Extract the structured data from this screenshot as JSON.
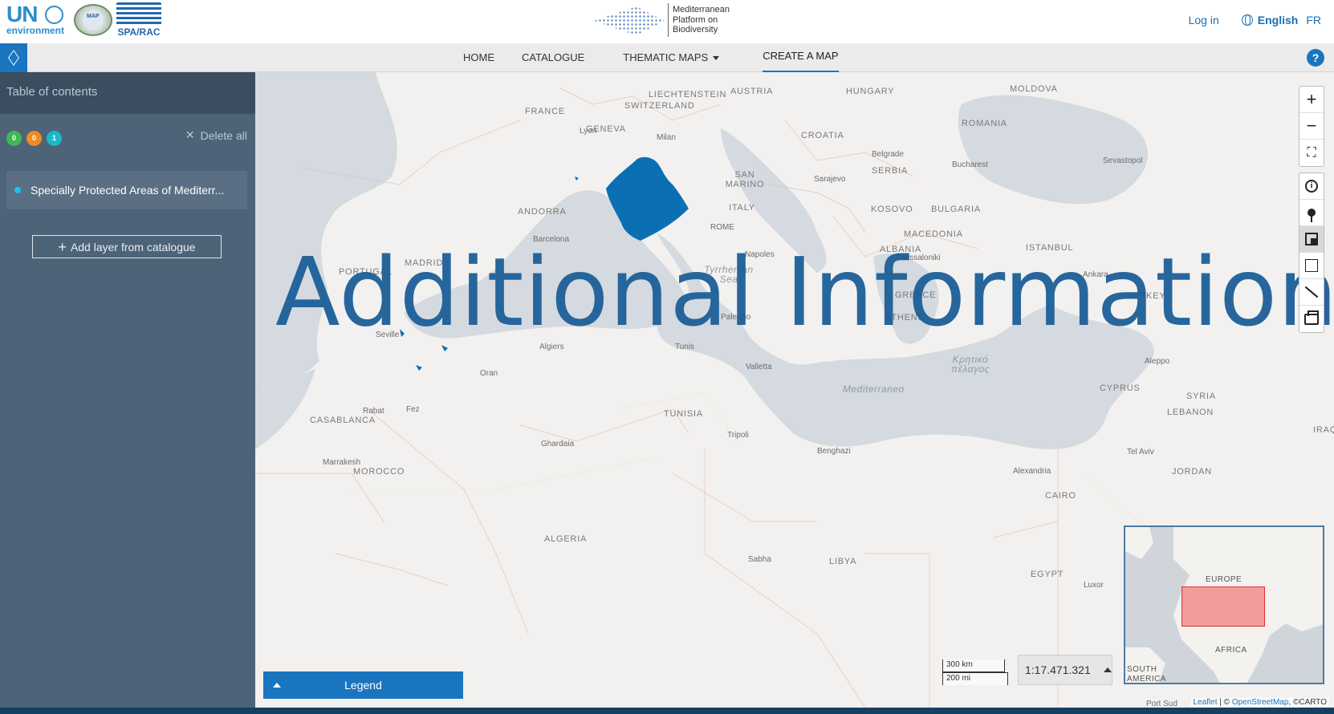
{
  "header": {
    "un_logo": "UN",
    "un_subtitle": "environment",
    "map_logo": "MAP",
    "spa_logo": "SPA/RAC",
    "platform_name_line1": "Mediterranean",
    "platform_name_line2": "Platform on",
    "platform_name_line3": "Biodiversity",
    "login": "Log in",
    "language_current": "English",
    "language_alt": "FR"
  },
  "nav": {
    "items": [
      {
        "label": "HOME"
      },
      {
        "label": "CATALOGUE"
      },
      {
        "label": "THEMATIC MAPS"
      },
      {
        "label": "CREATE A MAP"
      }
    ],
    "help": "?"
  },
  "sidebar": {
    "title": "Table of contents",
    "badges": [
      {
        "value": "0",
        "color": "#3fb94f"
      },
      {
        "value": "0",
        "color": "#ef8b23"
      },
      {
        "value": "1",
        "color": "#1bb9c8"
      }
    ],
    "delete_all": "Delete all",
    "layers": [
      {
        "name": "Specially Protected Areas of Mediterr..."
      }
    ],
    "add_layer": "Add layer from catalogue"
  },
  "map": {
    "overlay_text": "Additional Information",
    "labels": {
      "france": "FRANCE",
      "geneva": "GENEVA",
      "liechtenstein": "LIECHTENSTEIN",
      "switzerland": "SWITZERLAND",
      "austria": "AUSTRIA",
      "hungary": "HUNGARY",
      "moldova": "MOLDOVA",
      "romania": "ROMANIA",
      "croatia": "CROATIA",
      "lyon": "Lyon",
      "milan": "Milan",
      "belgrade": "Belgrade",
      "bucharest": "Bucharest",
      "sevastopol": "Sevastopol",
      "san_marino": "SAN MARINO",
      "sarajevo": "Sarajevo",
      "serbia": "SERBIA",
      "andorra": "ANDORRA",
      "italy": "ITALY",
      "kosovo": "KOSOVO",
      "bulgaria": "BULGARIA",
      "rome": "ROME",
      "barcelona": "Barcelona",
      "macedonia": "MACEDONIA",
      "madrid": "MADRID",
      "portugal": "PORTUGAL",
      "napoles": "Napoles",
      "albania": "ALBANIA",
      "istanbul": "ISTANBUL",
      "thessaloniki": "Thessaloniki",
      "ankara": "Ankara",
      "turkey": "TURKEY",
      "greece": "GREECE",
      "athens": "ATHENS",
      "tyrrhenian": "Tyrrhenian Sea",
      "palermo": "Palermo",
      "seville": "Seville",
      "algiers": "Algiers",
      "tunis": "Tunis",
      "valletta": "Valletta",
      "kritiko": "Κρητικό πέλαγος",
      "aleppo": "Aleppo",
      "oran": "Oran",
      "mediterraneo": "Mediterraneo",
      "cyprus": "CYPRUS",
      "syria": "SYRIA",
      "rabat": "Rabat",
      "fez": "Fez",
      "casablanca": "CASABLANCA",
      "tunisia": "TUNISIA",
      "tripoli": "Tripoli",
      "lebanon": "LEBANON",
      "iraq": "IRAQ",
      "ghardaia": "Ghardaia",
      "benghazi": "Benghazi",
      "tel_aviv": "Tel Aviv",
      "marrakesh": "Marrakesh",
      "morocco": "MOROCCO",
      "alexandria": "Alexandria",
      "jordan": "JORDAN",
      "cairo": "CAIRO",
      "algeria": "ALGERIA",
      "sabha": "Sabha",
      "libya": "LIBYA",
      "egypt": "EGYPT",
      "luxor": "Luxor",
      "port_sudan": "Port Sud"
    },
    "scale_km": "300 km",
    "scale_mi": "200 mi",
    "scale_ratio": "1:17.471.321",
    "overview": {
      "europe": "EUROPE",
      "africa": "AFRICA",
      "south": "SOUTH",
      "america": "AMERICA"
    },
    "attribution_leaflet": "Leaflet",
    "attribution_rest": " | © ",
    "attribution_osm": "OpenStreetMap",
    "attribution_carto": ", ©CARTO",
    "legend": "Legend"
  },
  "controls": {
    "zoom_in": "+",
    "zoom_out": "−"
  },
  "colors": {
    "accent": "#1a75c0",
    "sidebar": "#4d6377",
    "sea": "#d4dadf",
    "land": "#f2f1ef",
    "layer_fill": "#0a6fb3"
  }
}
